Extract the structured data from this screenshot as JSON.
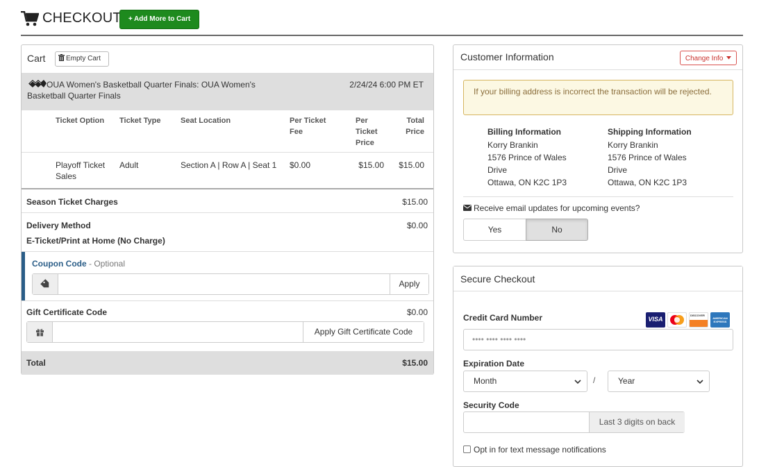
{
  "header": {
    "title": "CHECKOUT",
    "add_more_label": "+ Add More to Cart"
  },
  "cart": {
    "title": "Cart",
    "empty_cart_label": "Empty Cart",
    "event": {
      "name": "OUA Women's Basketball Quarter Finals: OUA Women's Basketball Quarter Finals",
      "date": "2/24/24 6:00 PM ET"
    },
    "columns": {
      "ticket_option": "Ticket Option",
      "ticket_type": "Ticket Type",
      "seat_location": "Seat Location",
      "per_ticket_fee": "Per Ticket Fee",
      "per_ticket_price": "Per Ticket Price",
      "total_price": "Total Price"
    },
    "line_item": {
      "ticket_option": "Playoff Ticket Sales",
      "ticket_type": "Adult",
      "seat_location": "Section A | Row A | Seat 1",
      "per_ticket_fee": "$0.00",
      "per_ticket_price": "$15.00",
      "total_price": "$15.00"
    },
    "season_charges": {
      "label": "Season Ticket Charges",
      "amount": "$15.00"
    },
    "delivery": {
      "label": "Delivery Method",
      "amount": "$0.00",
      "method": "E-Ticket/Print at Home (No Charge)"
    },
    "coupon": {
      "label": "Coupon Code",
      "optional": " - Optional",
      "value": "",
      "apply_label": "Apply"
    },
    "gift_certificate": {
      "label": "Gift Certificate Code",
      "amount": "$0.00",
      "value": "",
      "apply_label": "Apply Gift Certificate Code"
    },
    "total": {
      "label": "Total",
      "amount": "$15.00"
    }
  },
  "customer": {
    "title": "Customer Information",
    "change_info_label": "Change Info",
    "alert": "If your billing address is incorrect the transaction will be rejected.",
    "billing": {
      "heading": "Billing Information",
      "name": "Korry Brankin",
      "street1": "1576 Prince of Wales",
      "street2": "Drive",
      "city": "Ottawa, ON K2C 1P3"
    },
    "shipping": {
      "heading": "Shipping Information",
      "name": "Korry Brankin",
      "street1": "1576 Prince of Wales",
      "street2": "Drive",
      "city": "Ottawa, ON K2C 1P3"
    },
    "email_question": "Receive email updates for upcoming events?",
    "email_options": {
      "yes": "Yes",
      "no": "No",
      "selected": "No"
    }
  },
  "secure": {
    "title": "Secure Checkout",
    "card_number_label": "Credit Card Number",
    "card_number_placeholder": "•••• •••• •••• ••••",
    "card_logos": [
      "visa",
      "mastercard",
      "discover",
      "amex"
    ],
    "card_logo_text": {
      "visa": "VISA",
      "discover": "DISCOVER",
      "amex": "AMERICAN EXPRESS"
    },
    "expiration_label": "Expiration Date",
    "month": "Month",
    "separator": "/",
    "year": "Year",
    "security_code_label": "Security Code",
    "security_code_value": "",
    "security_code_hint": "Last 3 digits on back",
    "sms_opt_in": "Opt in for text message notifications"
  },
  "colors": {
    "green_button": "#1e8a1e",
    "coupon_accent": "#2a5d87",
    "alert_bg": "#fcf8e3",
    "danger": "#c9302c"
  }
}
